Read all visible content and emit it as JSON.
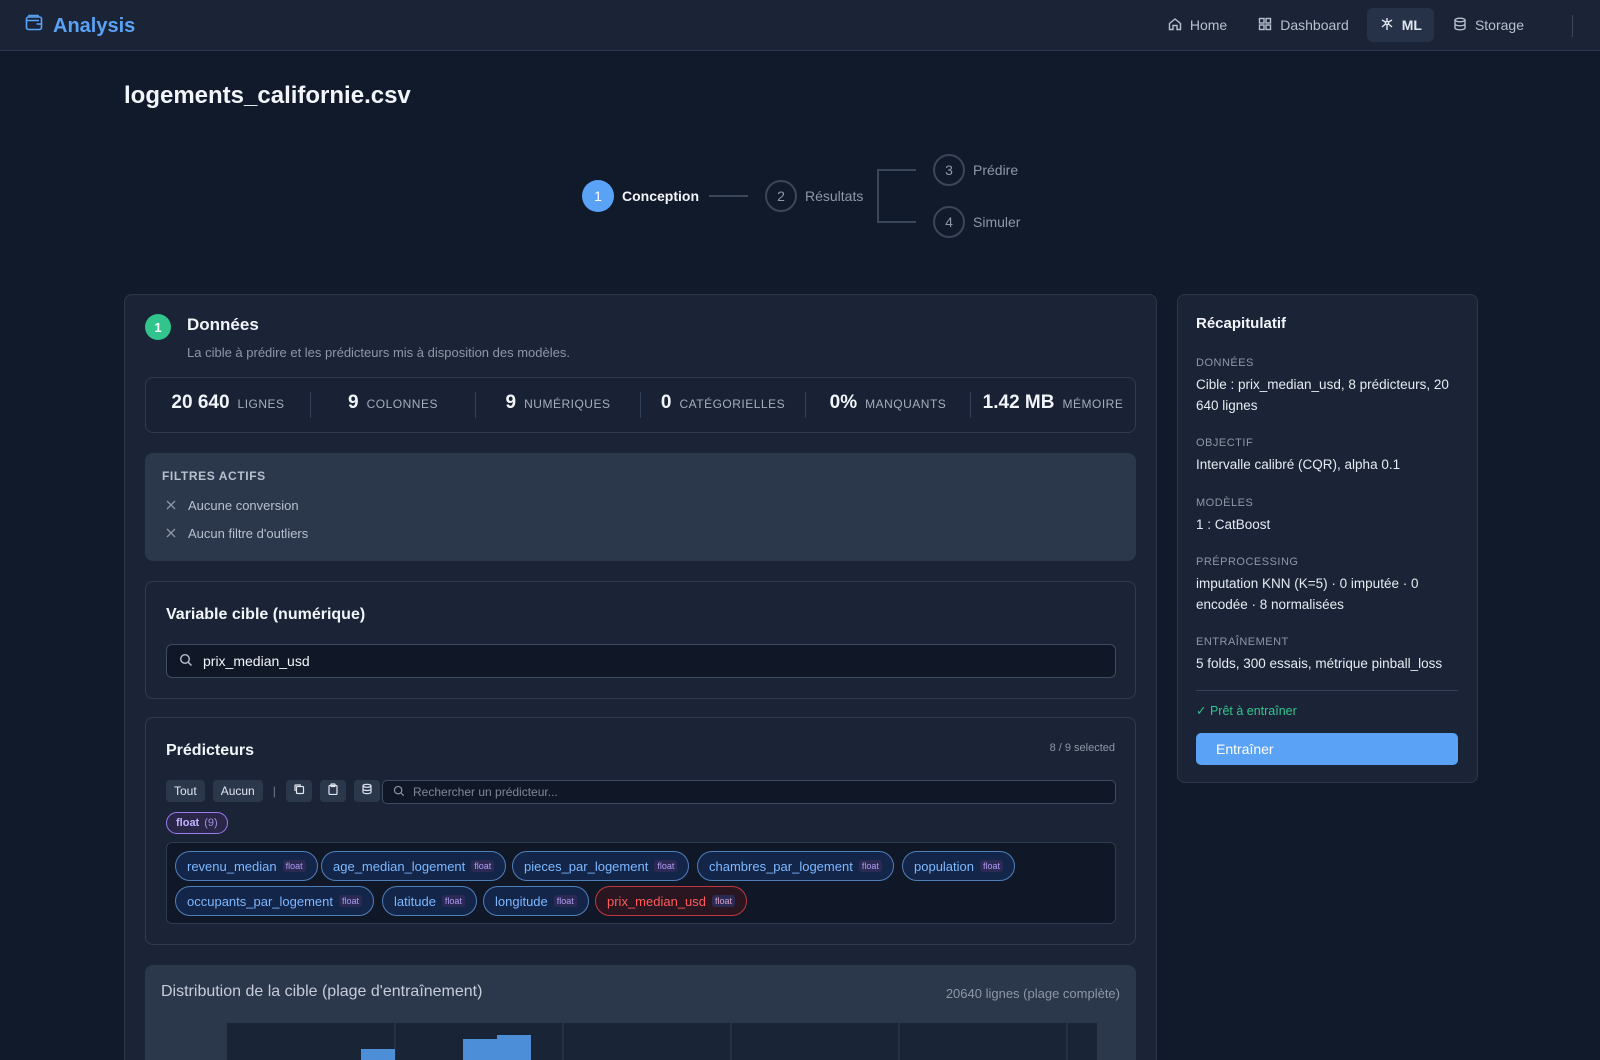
{
  "app": {
    "brand": "Analysis"
  },
  "nav": [
    {
      "label": "Home",
      "icon": "home-icon"
    },
    {
      "label": "Dashboard",
      "icon": "grid-icon"
    },
    {
      "label": "ML",
      "icon": "ml-icon",
      "active": true
    },
    {
      "label": "Storage",
      "icon": "database-icon"
    }
  ],
  "page": {
    "title": "logements_californie.csv"
  },
  "stepper": [
    {
      "num": "1",
      "label": "Conception",
      "active": true
    },
    {
      "num": "2",
      "label": "Résultats"
    },
    {
      "num": "3",
      "label": "Prédire"
    },
    {
      "num": "4",
      "label": "Simuler"
    }
  ],
  "data_section": {
    "badge": "1",
    "title": "Données",
    "subtitle": "La cible à prédire et les prédicteurs mis à disposition des modèles.",
    "stats": [
      {
        "value": "20 640",
        "label": "lignes"
      },
      {
        "value": "9",
        "label": "colonnes"
      },
      {
        "value": "9",
        "label": "numériques"
      },
      {
        "value": "0",
        "label": "catégorielles"
      },
      {
        "value": "0%",
        "label": "manquants"
      },
      {
        "value": "1.42 MB",
        "label": "mémoire"
      }
    ],
    "filters": {
      "title": "FILTRES ACTIFS",
      "items": [
        "Aucune conversion",
        "Aucun filtre d'outliers"
      ]
    },
    "target": {
      "title": "Variable cible (numérique)",
      "value": "prix_median_usd"
    },
    "predictors": {
      "title": "Prédicteurs",
      "count": "8 / 9 selected",
      "all_label": "Tout",
      "none_label": "Aucun",
      "separator": "|",
      "search_placeholder": "Rechercher un prédicteur...",
      "type_chip": {
        "label": "float",
        "count": "(9)"
      },
      "chips": [
        {
          "name": "revenu_median",
          "type": "float"
        },
        {
          "name": "age_median_logement",
          "type": "float"
        },
        {
          "name": "pieces_par_logement",
          "type": "float"
        },
        {
          "name": "chambres_par_logement",
          "type": "float"
        },
        {
          "name": "population",
          "type": "float"
        },
        {
          "name": "occupants_par_logement",
          "type": "float"
        },
        {
          "name": "latitude",
          "type": "float"
        },
        {
          "name": "longitude",
          "type": "float"
        },
        {
          "name": "prix_median_usd",
          "type": "float",
          "is_target": true
        }
      ]
    },
    "distribution": {
      "title": "Distribution de la cible (plage d'entraînement)",
      "meta": "20640 lignes (plage complète)"
    }
  },
  "summary": {
    "title": "Récapitulatif",
    "sections": [
      {
        "label": "Données",
        "value": "Cible : prix_median_usd, 8 prédicteurs, 20 640 lignes"
      },
      {
        "label": "Objectif",
        "value": "Intervalle calibré (CQR), alpha 0.1"
      },
      {
        "label": "Modèles",
        "value": "1 : CatBoost"
      },
      {
        "label": "Préprocessing",
        "value": "imputation KNN (K=5) · 0 imputée · 0 encodée · 8 normalisées"
      },
      {
        "label": "Entraînement",
        "value": "5 folds, 300 essais, métrique pinball_loss"
      }
    ],
    "ready": "✓ Prêt à entraîner",
    "train_label": "Entraîner"
  },
  "colors": {
    "accent": "#5aa2f5",
    "success": "#32c48d",
    "danger": "#ff5c5c",
    "float_tag": "#9b7cf0"
  }
}
